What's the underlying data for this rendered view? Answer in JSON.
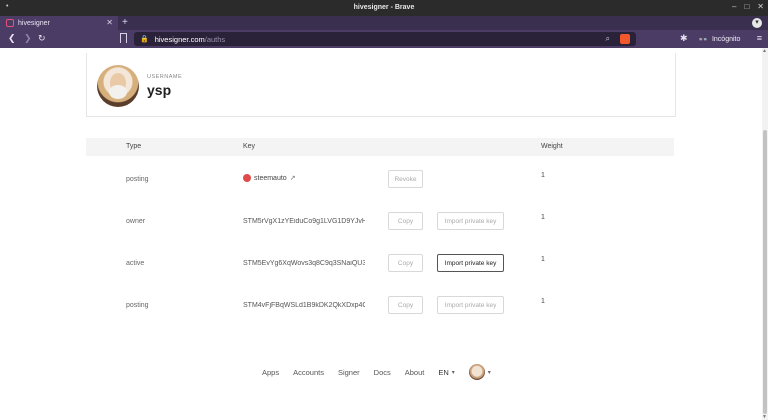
{
  "window": {
    "title": "hivesigner - Brave",
    "controls": [
      "–",
      "□",
      "✕"
    ]
  },
  "tabs": [
    {
      "label": "hivesigner",
      "close": "✕"
    }
  ],
  "toolbar": {
    "new_tab": "+",
    "back": "❮",
    "forward": "❯",
    "reload": "↻",
    "url_host": "hivesigner.com",
    "url_path": "/auths",
    "incognito_label": "Incógnito"
  },
  "profile": {
    "username_label": "USERNAME",
    "username": "ysp"
  },
  "table": {
    "headers": {
      "type": "Type",
      "key": "Key",
      "weight": "Weight"
    },
    "rows": [
      {
        "type": "posting",
        "key": "steemauto",
        "key_is_app": true,
        "buttons": [
          {
            "label": "Revoke",
            "enabled": false
          }
        ],
        "weight": "1"
      },
      {
        "type": "owner",
        "key": "STM5rVgX1zYEiduCo9g1LVG1D9YJvHF",
        "key_is_app": false,
        "buttons": [
          {
            "label": "Copy",
            "enabled": false
          },
          {
            "label": "Import private key",
            "enabled": false
          }
        ],
        "weight": "1"
      },
      {
        "type": "active",
        "key": "STM5EvYg6XqWovs3q8C9q3SNaiQU3",
        "key_is_app": false,
        "buttons": [
          {
            "label": "Copy",
            "enabled": false
          },
          {
            "label": "Import private key",
            "enabled": true
          }
        ],
        "weight": "1"
      },
      {
        "type": "posting",
        "key": "STM4vFjFBqWSLd1B9kDK2QkXDxp4C",
        "key_is_app": false,
        "buttons": [
          {
            "label": "Copy",
            "enabled": false
          },
          {
            "label": "Import private key",
            "enabled": false
          }
        ],
        "weight": "1"
      }
    ]
  },
  "footer": {
    "links": [
      "Apps",
      "Accounts",
      "Signer",
      "Docs",
      "About"
    ],
    "language": "EN"
  },
  "colors": {
    "titlebar": "#2b2b2b",
    "browser_chrome": "#4b3c66",
    "url_field": "#2a2238",
    "brave_accent": "#f1582b"
  }
}
